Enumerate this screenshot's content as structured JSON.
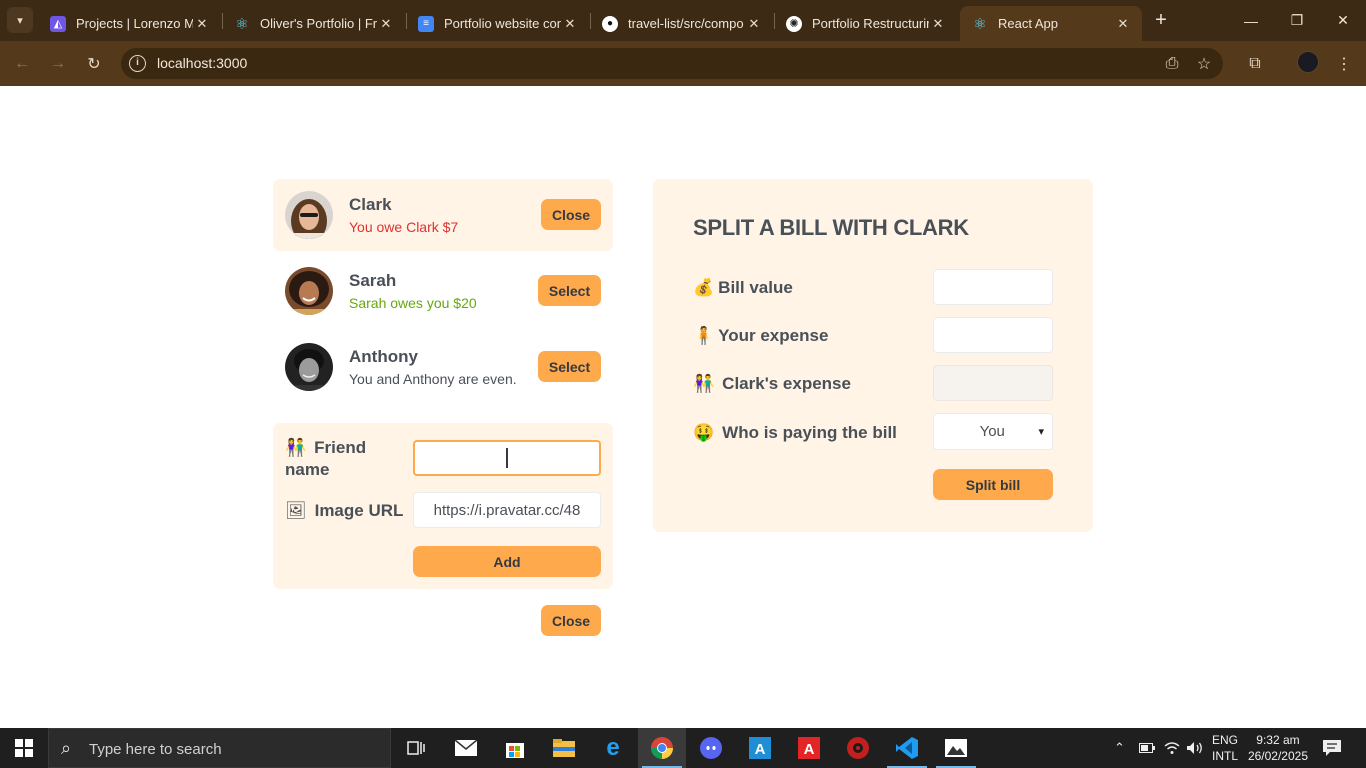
{
  "browser": {
    "tabs": [
      {
        "title": "Projects | Lorenzo Mis",
        "favicon": "glitch-icon",
        "color": "#7b61ff"
      },
      {
        "title": "Oliver's Portfolio | Fro",
        "favicon": "react-icon",
        "color": "#61dafb"
      },
      {
        "title": "Portfolio website cont",
        "favicon": "google-docs-icon",
        "color": "#4285f4"
      },
      {
        "title": "travel-list/src/compo",
        "favicon": "github-icon",
        "color": "#ffffff"
      },
      {
        "title": "Portfolio Restructurin",
        "favicon": "chatgpt-icon",
        "color": "#ffffff"
      },
      {
        "title": "React App",
        "favicon": "react-icon",
        "color": "#61dafb"
      }
    ],
    "address": "localhost:3000"
  },
  "friends": [
    {
      "name": "Clark",
      "balance_text": "You owe Clark $7",
      "balance_state": "owe",
      "button": "Close",
      "selected": true
    },
    {
      "name": "Sarah",
      "balance_text": "Sarah owes you $20",
      "balance_state": "owed",
      "button": "Select",
      "selected": false
    },
    {
      "name": "Anthony",
      "balance_text": "You and Anthony are even.",
      "balance_state": "even",
      "button": "Select",
      "selected": false
    }
  ],
  "add_friend": {
    "name_label": "Friend name",
    "name_emoji": "👫",
    "name_value": "",
    "image_label": "Image URL",
    "image_emoji": "🖼",
    "image_value": "https://i.pravatar.cc/48",
    "add_button": "Add"
  },
  "close_button": "Close",
  "split_bill": {
    "title": "SPLIT A BILL WITH CLARK",
    "bill_label": "Bill value",
    "bill_emoji": "💰",
    "bill_value": "",
    "your_label": "Your expense",
    "your_emoji": "🧍",
    "your_value": "",
    "friend_label": "Clark's expense",
    "friend_emoji": "👫",
    "friend_value": "",
    "payer_label": "Who is paying the bill",
    "payer_emoji": "🤑",
    "payer_selected": "You",
    "submit": "Split bill"
  },
  "taskbar": {
    "search_placeholder": "Type here to search",
    "language_line1": "ENG",
    "language_line2": "INTL",
    "time": "9:32 am",
    "date": "26/02/2025"
  }
}
